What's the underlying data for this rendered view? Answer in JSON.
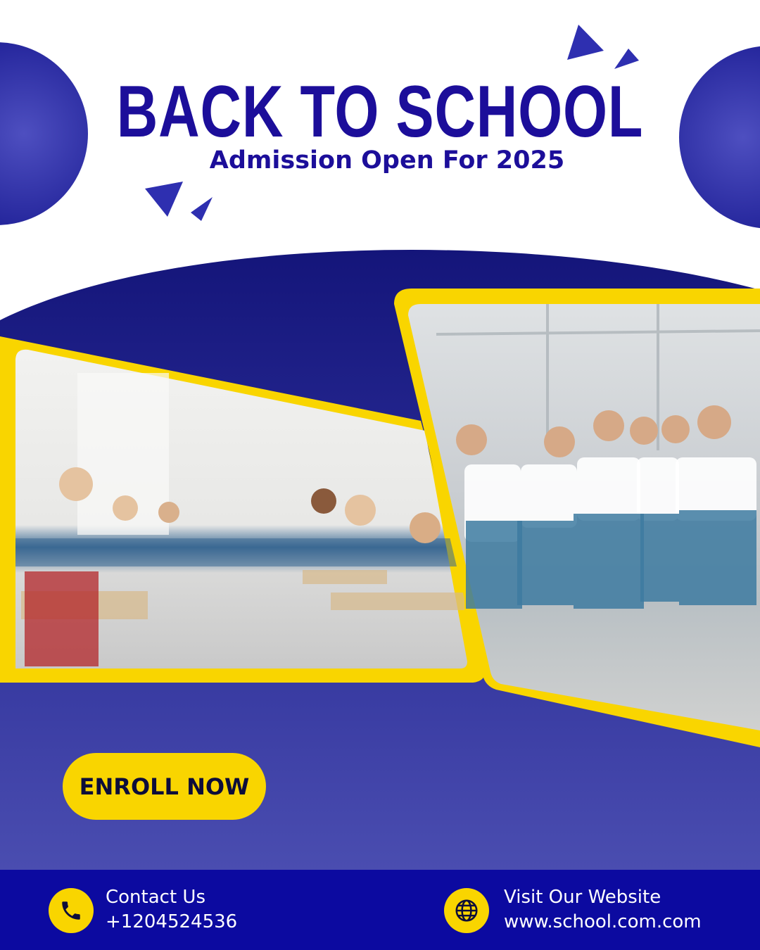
{
  "header": {
    "title": "BACK TO SCHOOL",
    "subtitle": "Admission Open For 2025"
  },
  "cta": {
    "enroll_label": "ENROLL NOW"
  },
  "footer": {
    "contact": {
      "label": "Contact Us",
      "phone": "+1204524536",
      "icon": "phone-icon"
    },
    "website": {
      "label": "Visit Our Website",
      "url": "www.school.com.com",
      "icon": "globe-icon"
    }
  },
  "colors": {
    "primary_blue": "#1c0e9a",
    "accent_yellow": "#f9d500",
    "navy": "#14157a",
    "panel_blue": "#4245ab",
    "footer_blue": "#0c0aa0"
  }
}
